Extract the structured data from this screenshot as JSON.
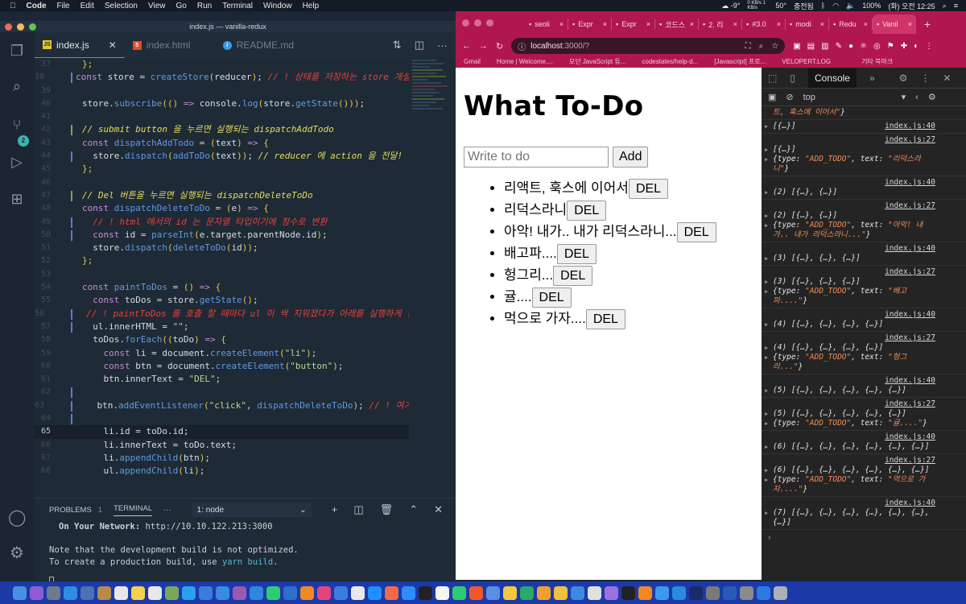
{
  "menubar": {
    "apple_icon": "",
    "app": "Code",
    "items": [
      "File",
      "Edit",
      "Selection",
      "View",
      "Go",
      "Run",
      "Terminal",
      "Window",
      "Help"
    ],
    "status": {
      "weather": "-9°",
      "net": "0 KB/s 1 KB/s",
      "temp": "50°",
      "input_source": "충전됨",
      "battery": "100%",
      "datetime": "(화) 오전 12:25"
    }
  },
  "vscode": {
    "window_title": "index.js — vanilla-redux",
    "scm_badge": "2",
    "tabs": [
      {
        "label": "index.js",
        "icon": "JS",
        "active": true
      },
      {
        "label": "index.html",
        "icon": "5",
        "active": false
      },
      {
        "label": "README.md",
        "icon": "i",
        "active": false
      }
    ],
    "editor_lines": [
      {
        "n": "37",
        "code": [
          [
            "p",
            "};"
          ]
        ]
      },
      {
        "n": "38",
        "code": [
          [
            "k",
            "const "
          ],
          [
            "st",
            "store = "
          ],
          [
            "f",
            "createStore"
          ],
          [
            "p",
            "("
          ],
          [
            "st",
            "reducer"
          ],
          [
            "p",
            ")"
          ],
          [
            "st",
            "; "
          ],
          [
            "cr",
            "// ! 상태를 저장하는 store 개설"
          ]
        ],
        "mark": "#6d74c8"
      },
      {
        "n": "39",
        "code": []
      },
      {
        "n": "40",
        "code": [
          [
            "st",
            "store."
          ],
          [
            "f",
            "subscribe"
          ],
          [
            "p",
            "(("
          ],
          [
            "p",
            ")"
          ],
          [
            "k",
            " => "
          ],
          [
            "st",
            "console."
          ],
          [
            "f",
            "log"
          ],
          [
            "p",
            "("
          ],
          [
            "st",
            "store."
          ],
          [
            "f",
            "getState"
          ],
          [
            "p",
            "()))"
          ],
          [
            "st",
            ";"
          ]
        ]
      },
      {
        "n": "41",
        "code": []
      },
      {
        "n": "42",
        "code": [
          [
            "cm",
            "// submit button 을 누르면 실행되는 dispatchAddTodo"
          ]
        ],
        "mark": "#88a05a"
      },
      {
        "n": "43",
        "code": [
          [
            "k",
            "const "
          ],
          [
            "f",
            "dispatchAddTodo"
          ],
          [
            "st",
            " = "
          ],
          [
            "p",
            "("
          ],
          [
            "st",
            "text"
          ],
          [
            "p",
            ")"
          ],
          [
            "k",
            " => "
          ],
          [
            "p",
            "{"
          ]
        ]
      },
      {
        "n": "44",
        "code": [
          [
            "st",
            "  store."
          ],
          [
            "f",
            "dispatch"
          ],
          [
            "p",
            "("
          ],
          [
            "f",
            "addToDo"
          ],
          [
            "p",
            "("
          ],
          [
            "st",
            "text"
          ],
          [
            "p",
            "))"
          ],
          [
            "st",
            "; "
          ],
          [
            "cm",
            "// reducer 에 action 을 전달!"
          ]
        ],
        "mark": "#6d74c8"
      },
      {
        "n": "45",
        "code": [
          [
            "p",
            "};"
          ]
        ]
      },
      {
        "n": "46",
        "code": []
      },
      {
        "n": "47",
        "code": [
          [
            "cm",
            "// Del 버튼을 누르면 실행되는 dispatchDeleteToDo"
          ]
        ],
        "mark": "#88a05a"
      },
      {
        "n": "48",
        "code": [
          [
            "k",
            "const "
          ],
          [
            "f",
            "dispatchDeleteToDo"
          ],
          [
            "st",
            " = "
          ],
          [
            "p",
            "("
          ],
          [
            "st",
            "e"
          ],
          [
            "p",
            ")"
          ],
          [
            "k",
            " => "
          ],
          [
            "p",
            "{"
          ]
        ]
      },
      {
        "n": "49",
        "code": [
          [
            "cr",
            "  // ! html 에서의 id 는 문자열 타입이기에 정수로 변환"
          ]
        ],
        "mark": "#6d74c8"
      },
      {
        "n": "50",
        "code": [
          [
            "k",
            "  const "
          ],
          [
            "st",
            "id = "
          ],
          [
            "f",
            "parseInt"
          ],
          [
            "p",
            "("
          ],
          [
            "st",
            "e.target.parentNode.id"
          ],
          [
            "p",
            ")"
          ],
          [
            "st",
            ";"
          ]
        ],
        "mark": "#6d74c8"
      },
      {
        "n": "51",
        "code": [
          [
            "st",
            "  store."
          ],
          [
            "f",
            "dispatch"
          ],
          [
            "p",
            "("
          ],
          [
            "f",
            "deleteToDo"
          ],
          [
            "p",
            "("
          ],
          [
            "st",
            "id"
          ],
          [
            "p",
            "))"
          ],
          [
            "st",
            ";"
          ]
        ]
      },
      {
        "n": "52",
        "code": [
          [
            "p",
            "};"
          ]
        ]
      },
      {
        "n": "53",
        "code": []
      },
      {
        "n": "54",
        "code": [
          [
            "k",
            "const "
          ],
          [
            "f",
            "paintToDos"
          ],
          [
            "st",
            " = "
          ],
          [
            "p",
            "()"
          ],
          [
            "k",
            " => "
          ],
          [
            "p",
            "{"
          ]
        ]
      },
      {
        "n": "55",
        "code": [
          [
            "k",
            "  const "
          ],
          [
            "st",
            "toDos = store."
          ],
          [
            "f",
            "getState"
          ],
          [
            "p",
            "()"
          ],
          [
            "st",
            ";"
          ]
        ]
      },
      {
        "n": "56",
        "code": [
          [
            "cr",
            "  // ! paintToDos 를 호출 할 때마다 ul 이 싹 지워졌다가 아래를 실행하게 한다"
          ]
        ],
        "mark": "#6d74c8"
      },
      {
        "n": "57",
        "code": [
          [
            "st",
            "  ul.innerHTML = "
          ],
          [
            "s",
            "\"\""
          ],
          [
            "st",
            ";"
          ]
        ],
        "mark": "#6d74c8"
      },
      {
        "n": "58",
        "code": [
          [
            "st",
            "  toDos."
          ],
          [
            "f",
            "forEach"
          ],
          [
            "p",
            "(("
          ],
          [
            "st",
            "toDo"
          ],
          [
            "p",
            ")"
          ],
          [
            "k",
            " => "
          ],
          [
            "p",
            "{"
          ]
        ]
      },
      {
        "n": "59",
        "code": [
          [
            "k",
            "    const "
          ],
          [
            "st",
            "li = document."
          ],
          [
            "f",
            "createElement"
          ],
          [
            "p",
            "("
          ],
          [
            "s",
            "\"li\""
          ],
          [
            "p",
            ")"
          ],
          [
            "st",
            ";"
          ]
        ]
      },
      {
        "n": "60",
        "code": [
          [
            "k",
            "    const "
          ],
          [
            "st",
            "btn = document."
          ],
          [
            "f",
            "createElement"
          ],
          [
            "p",
            "("
          ],
          [
            "s",
            "\"button\""
          ],
          [
            "p",
            ")"
          ],
          [
            "st",
            ";"
          ]
        ]
      },
      {
        "n": "61",
        "code": [
          [
            "st",
            "    btn.innerText = "
          ],
          [
            "s",
            "\"DEL\""
          ],
          [
            "st",
            ";"
          ]
        ]
      },
      {
        "n": "62",
        "code": [],
        "mark": "#6d74c8"
      },
      {
        "n": "63",
        "code": [
          [
            "st",
            "    btn."
          ],
          [
            "f",
            "addEventListener"
          ],
          [
            "p",
            "("
          ],
          [
            "s",
            "\"click\""
          ],
          [
            "st",
            ", "
          ],
          [
            "f",
            "dispatchDeleteToDo"
          ],
          [
            "p",
            ")"
          ],
          [
            "st",
            "; "
          ],
          [
            "cr",
            "// ! 여기"
          ]
        ],
        "mark": "#6d74c8"
      },
      {
        "n": "64",
        "code": [],
        "mark": "#6d74c8"
      },
      {
        "n": "65",
        "code": [
          [
            "st",
            "    li.id = toDo.id;"
          ]
        ],
        "current": true
      },
      {
        "n": "66",
        "code": [
          [
            "st",
            "    li.innerText = toDo.text;"
          ]
        ]
      },
      {
        "n": "67",
        "code": [
          [
            "st",
            "    li."
          ],
          [
            "f",
            "appendChild"
          ],
          [
            "p",
            "("
          ],
          [
            "st",
            "btn"
          ],
          [
            "p",
            ")"
          ],
          [
            "st",
            ";"
          ]
        ]
      },
      {
        "n": "68",
        "code": [
          [
            "st",
            "    ul."
          ],
          [
            "f",
            "appendChild"
          ],
          [
            "p",
            "("
          ],
          [
            "st",
            "li"
          ],
          [
            "p",
            ")"
          ],
          [
            "st",
            ";"
          ]
        ]
      }
    ],
    "panel": {
      "problems_label": "PROBLEMS",
      "problems_count": "1",
      "terminal_label": "TERMINAL",
      "more": "···",
      "terminal_select": "1: node",
      "lines": {
        "network_label": "On Your Network:",
        "network_url": "http://10.10.122.213:3000",
        "note": "Note that the development build is not optimized.",
        "prod_prefix": "To create a production build, use ",
        "prod_cmd": "yarn build",
        "prod_suffix": "."
      }
    }
  },
  "chrome": {
    "tabs": [
      {
        "label": "seoli"
      },
      {
        "label": "Expr"
      },
      {
        "label": "Expr"
      },
      {
        "label": "코드스"
      },
      {
        "label": "2. 리"
      },
      {
        "label": "#3.0"
      },
      {
        "label": "modi"
      },
      {
        "label": "Redu"
      },
      {
        "label": "Vanil",
        "active": true
      }
    ],
    "new_tab": "+",
    "address": {
      "host": "localhost",
      "rest": ":3000/?"
    },
    "bookmarks": [
      "Gmail",
      "Home | Welcome,...",
      "모던 JavaScript 튜...",
      "codestates/help-d...",
      "[Javascript] 프로...",
      "VELOPERT.LOG",
      "기타 북마크"
    ]
  },
  "page": {
    "title": "What To-Do",
    "input_placeholder": "Write to do",
    "add_label": "Add",
    "todos": [
      "리액트, 훅스에 이어서",
      "리덕스라니",
      "아악! 내가.. 내가 리덕스라니...",
      "배고파....",
      "헝그리...",
      "귤....",
      "먹으로 가자...."
    ],
    "del_label": "DEL"
  },
  "devtools": {
    "tab": "Console",
    "more": "»",
    "context": "top",
    "logs": [
      {
        "src": "",
        "lines": [
          [
            [
              "o",
              "트, 훅스에 이어서\""
            ],
            [
              "",
              "}"
            ]
          ]
        ]
      },
      {
        "src": "index.js:40",
        "lines": [
          [
            [
              "",
              "[{…}]"
            ]
          ]
        ]
      },
      {
        "src": "index.js:27",
        "lines": [
          [
            [
              "",
              "[{…}]"
            ]
          ],
          [
            [
              "",
              "{type: "
            ],
            [
              "o",
              "\"ADD_TODO\""
            ],
            [
              "",
              ", text: "
            ],
            [
              "o",
              "\"리덕스라니\""
            ],
            [
              "",
              "}"
            ]
          ]
        ]
      },
      {
        "src": "index.js:40",
        "lines": [
          [
            [
              "",
              "(2) [{…}, {…}]"
            ]
          ]
        ]
      },
      {
        "src": "index.js:27",
        "lines": [
          [
            [
              "",
              "(2) [{…}, {…}]"
            ]
          ],
          [
            [
              "",
              "{type: "
            ],
            [
              "o",
              "\"ADD_TODO\""
            ],
            [
              "",
              ", text: "
            ],
            [
              "o",
              "\"아악! 내가.. 내가 리덕스라니...\""
            ],
            [
              "",
              "}"
            ]
          ]
        ]
      },
      {
        "src": "index.js:40",
        "lines": [
          [
            [
              "",
              "(3) [{…}, {…}, {…}]"
            ]
          ]
        ]
      },
      {
        "src": "index.js:27",
        "lines": [
          [
            [
              "",
              "(3) [{…}, {…}, {…}]"
            ]
          ],
          [
            [
              "",
              "{type: "
            ],
            [
              "o",
              "\"ADD_TODO\""
            ],
            [
              "",
              ", text: "
            ],
            [
              "o",
              "\"배고파....\""
            ],
            [
              "",
              "}"
            ]
          ]
        ]
      },
      {
        "src": "index.js:40",
        "lines": [
          [
            [
              "",
              "(4) [{…}, {…}, {…}, {…}]"
            ]
          ]
        ]
      },
      {
        "src": "index.js:27",
        "lines": [
          [
            [
              "",
              "(4) [{…}, {…}, {…}, {…}]"
            ]
          ],
          [
            [
              "",
              "{type: "
            ],
            [
              "o",
              "\"ADD_TODO\""
            ],
            [
              "",
              ", text: "
            ],
            [
              "o",
              "\"헝그리...\""
            ],
            [
              "",
              "}"
            ]
          ]
        ]
      },
      {
        "src": "index.js:40",
        "lines": [
          [
            [
              "",
              "(5) [{…}, {…}, {…}, {…}, {…}]"
            ]
          ]
        ]
      },
      {
        "src": "index.js:27",
        "lines": [
          [
            [
              "",
              "(5) [{…}, {…}, {…}, {…}, {…}]"
            ]
          ],
          [
            [
              "",
              "{type: "
            ],
            [
              "o",
              "\"ADD_TODO\""
            ],
            [
              "",
              ", text: "
            ],
            [
              "o",
              "\"귤....\""
            ],
            [
              "",
              "}"
            ]
          ]
        ]
      },
      {
        "src": "index.js:40",
        "lines": [
          [
            [
              "",
              "(6) [{…}, {…}, {…}, {…}, {…}, {…}]"
            ]
          ]
        ]
      },
      {
        "src": "index.js:27",
        "lines": [
          [
            [
              "",
              "(6) [{…}, {…}, {…}, {…}, {…}, {…}]"
            ]
          ],
          [
            [
              "",
              "{type: "
            ],
            [
              "o",
              "\"ADD_TODO\""
            ],
            [
              "",
              ", text: "
            ],
            [
              "o",
              "\"먹으로 가자....\""
            ],
            [
              "",
              "}"
            ]
          ]
        ]
      },
      {
        "src": "index.js:40",
        "lines": [
          [
            [
              "",
              "(7) [{…}, {…}, {…}, {…}, {…}, {…}, {…}]"
            ]
          ]
        ]
      }
    ],
    "prompt": "›"
  },
  "colors": {
    "chrome_frame": "#b0174f",
    "vscode_bg": "#1e2a36",
    "devtools_bg": "#242424",
    "dock": "#1c3aa8"
  }
}
